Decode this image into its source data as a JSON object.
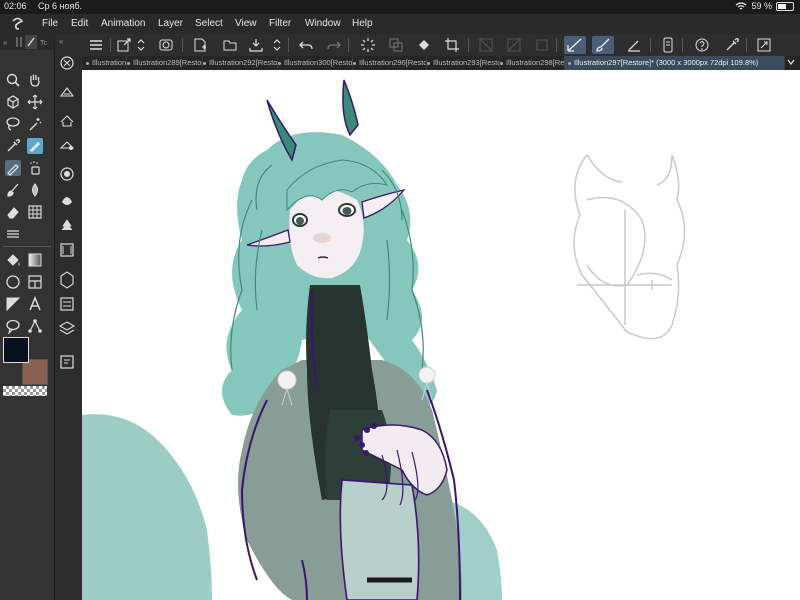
{
  "status_bar": {
    "time": "02:06",
    "date": "Ср 6 нояб.",
    "battery_text": "59 %",
    "battery_level": 0.59
  },
  "menu": {
    "items": [
      "File",
      "Edit",
      "Animation",
      "Layer",
      "Select",
      "View",
      "Filter",
      "Window",
      "Help"
    ]
  },
  "toolbar": {
    "buttons": [
      "menu-icon",
      "transform-icon",
      "stepper-icon",
      "clip-icon",
      "new-file-icon",
      "open-folder-icon",
      "save-icon",
      "stepper2-icon",
      "undo-icon",
      "redo-icon",
      "loading-icon",
      "copy-icon",
      "fill-icon",
      "crop-icon",
      "disabled-icon-1",
      "disabled-icon-2",
      "disabled-icon-3",
      "pen-select-icon",
      "brush-icon",
      "pencil-icon",
      "phone-icon",
      "help-icon",
      "eyedropper-icon",
      "expand-icon"
    ]
  },
  "tabs": {
    "items": [
      {
        "label": "Illustration288[Restore]",
        "active": false
      },
      {
        "label": "Illustration289[Restore]",
        "active": false
      },
      {
        "label": "Illustration292[Restore]",
        "active": false
      },
      {
        "label": "Illustration300[Restore]",
        "active": false
      },
      {
        "label": "Illustration296[Restore]",
        "active": false
      },
      {
        "label": "Illustration293[Restore]",
        "active": false
      },
      {
        "label": "Illustration298[Restore]",
        "active": false
      },
      {
        "label": "Illustration297[Restore]* (3000 x 3000px 72dpi 109.8%)",
        "active": true
      }
    ]
  },
  "left_tools": {
    "header_label": "Tc",
    "tools": [
      "zoom-icon",
      "hand-icon",
      "move-layer-icon",
      "move-icon",
      "lasso-select-icon",
      "magic-wand-icon",
      "eyedropper-tool-icon",
      "pen-tool-icon",
      "pencil-tool-icon",
      "airbrush-icon",
      "brush-tool-icon",
      "blend-icon",
      "eraser-icon",
      "grid-icon",
      "ruler-icon",
      "fill-tool-icon",
      "gradient-icon",
      "ellipse-icon",
      "frame-icon",
      "shape-icon",
      "text-icon",
      "balloon-icon",
      "correct-line-icon"
    ],
    "main_color": "#0a1020",
    "sub_color": "#8a6050"
  },
  "canvas": {
    "background": "#ffffff"
  },
  "colors": {
    "ui_dark": "#2b2b2b",
    "accent": "#4d5f78",
    "teal_hair": "#82c6bb",
    "outline_purple": "#3a1670"
  }
}
